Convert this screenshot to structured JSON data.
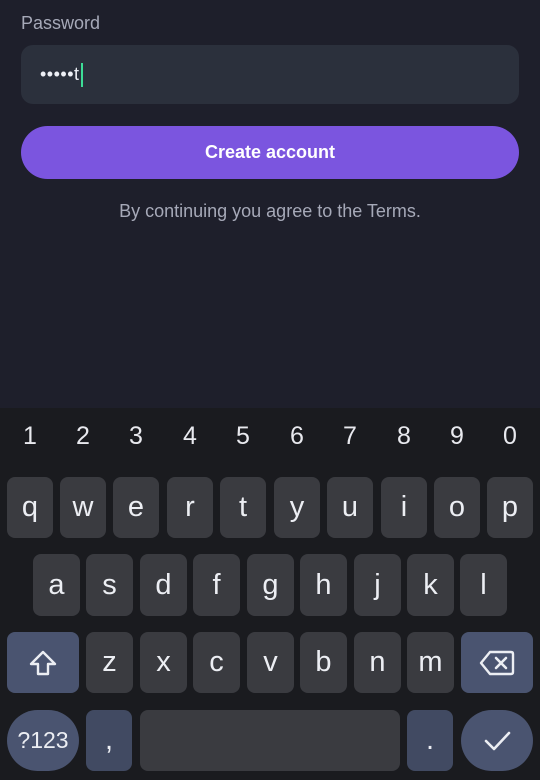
{
  "form": {
    "password_label": "Password",
    "password_value": "•••••t",
    "create_button_label": "Create account",
    "terms_text": "By continuing you agree to the Terms."
  },
  "keyboard": {
    "numbers": [
      "1",
      "2",
      "3",
      "4",
      "5",
      "6",
      "7",
      "8",
      "9",
      "0"
    ],
    "row1": [
      "q",
      "w",
      "e",
      "r",
      "t",
      "y",
      "u",
      "i",
      "o",
      "p"
    ],
    "row2": [
      "a",
      "s",
      "d",
      "f",
      "g",
      "h",
      "j",
      "k",
      "l"
    ],
    "row3": [
      "z",
      "x",
      "c",
      "v",
      "b",
      "n",
      "m"
    ],
    "symbols_label": "?123",
    "comma_label": ",",
    "period_label": ".",
    "shift_icon": "shift-icon",
    "backspace_icon": "backspace-icon",
    "enter_icon": "checkmark-icon"
  }
}
